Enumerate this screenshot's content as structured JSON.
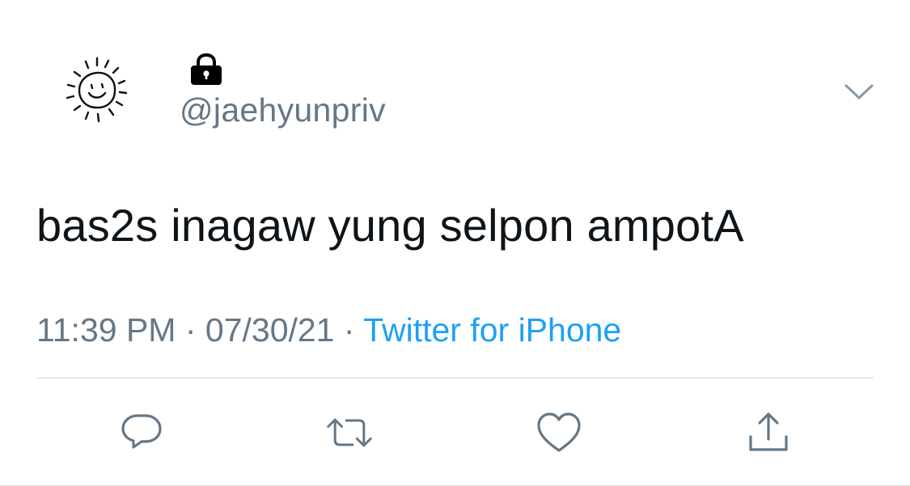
{
  "tweet": {
    "handle": "@jaehyunpriv",
    "text": "bas2s inagaw yung selpon ampotA",
    "time": "11:39 PM",
    "separator": " · ",
    "date": "07/30/21",
    "source": "Twitter for iPhone",
    "protected_icon": "lock-icon",
    "avatar_icon": "sun-doodle-icon"
  },
  "actions": [
    {
      "name": "reply",
      "icon": "reply-icon"
    },
    {
      "name": "retweet",
      "icon": "retweet-icon"
    },
    {
      "name": "like",
      "icon": "heart-icon"
    },
    {
      "name": "share",
      "icon": "share-icon"
    }
  ],
  "colors": {
    "text": "#0f1419",
    "secondary": "#657786",
    "link": "#1da1f2",
    "divider": "#ccd6dd"
  }
}
